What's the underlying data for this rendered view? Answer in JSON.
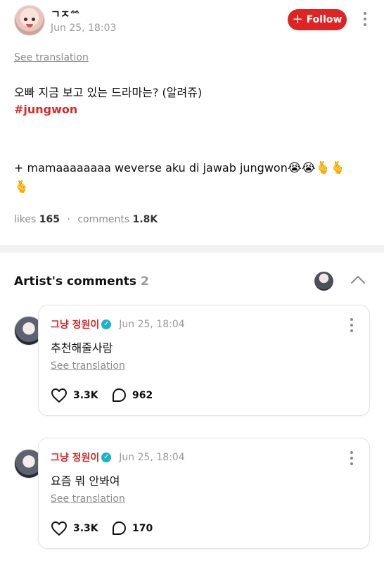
{
  "post": {
    "username": "ㄱㅈ",
    "username_glyph": "ᨐ",
    "date": "Jun 25, 18:03",
    "follow_label": "Follow",
    "see_translation": "See translation",
    "line1": "오빠 지금 보고 있는 드라마는? (알려쥬)",
    "hashtag": "#jungwon",
    "line2": "+ mamaaaaaaaa weverse aku di jawab jungwon",
    "emojis_line2": "😭😭🫰🫰",
    "emoji_line3": "🫰",
    "likes_label": "likes",
    "likes_count": "165",
    "comments_label": "comments",
    "comments_count": "1.8K"
  },
  "artist_section": {
    "title": "Artist's comments",
    "count": "2"
  },
  "comments": [
    {
      "name": "그냥 정원이",
      "date": "Jun 25, 18:04",
      "text": "추천해줄사람",
      "see_translation": "See translation",
      "likes": "3.3K",
      "replies": "962"
    },
    {
      "name": "그냥 정원이",
      "date": "Jun 25, 18:04",
      "text": "요즘 뭐 안봐여",
      "see_translation": "See translation",
      "likes": "3.3K",
      "replies": "170"
    }
  ],
  "icons": {
    "verified": "verified-check-icon",
    "heart": "heart-icon",
    "reply": "comment-bubble-icon",
    "more": "more-vertical-icon",
    "collapse": "chevron-up-icon"
  },
  "colors": {
    "accent": "#e02424",
    "hashtag": "#d42a2a",
    "verified": "#1bb3c6"
  }
}
